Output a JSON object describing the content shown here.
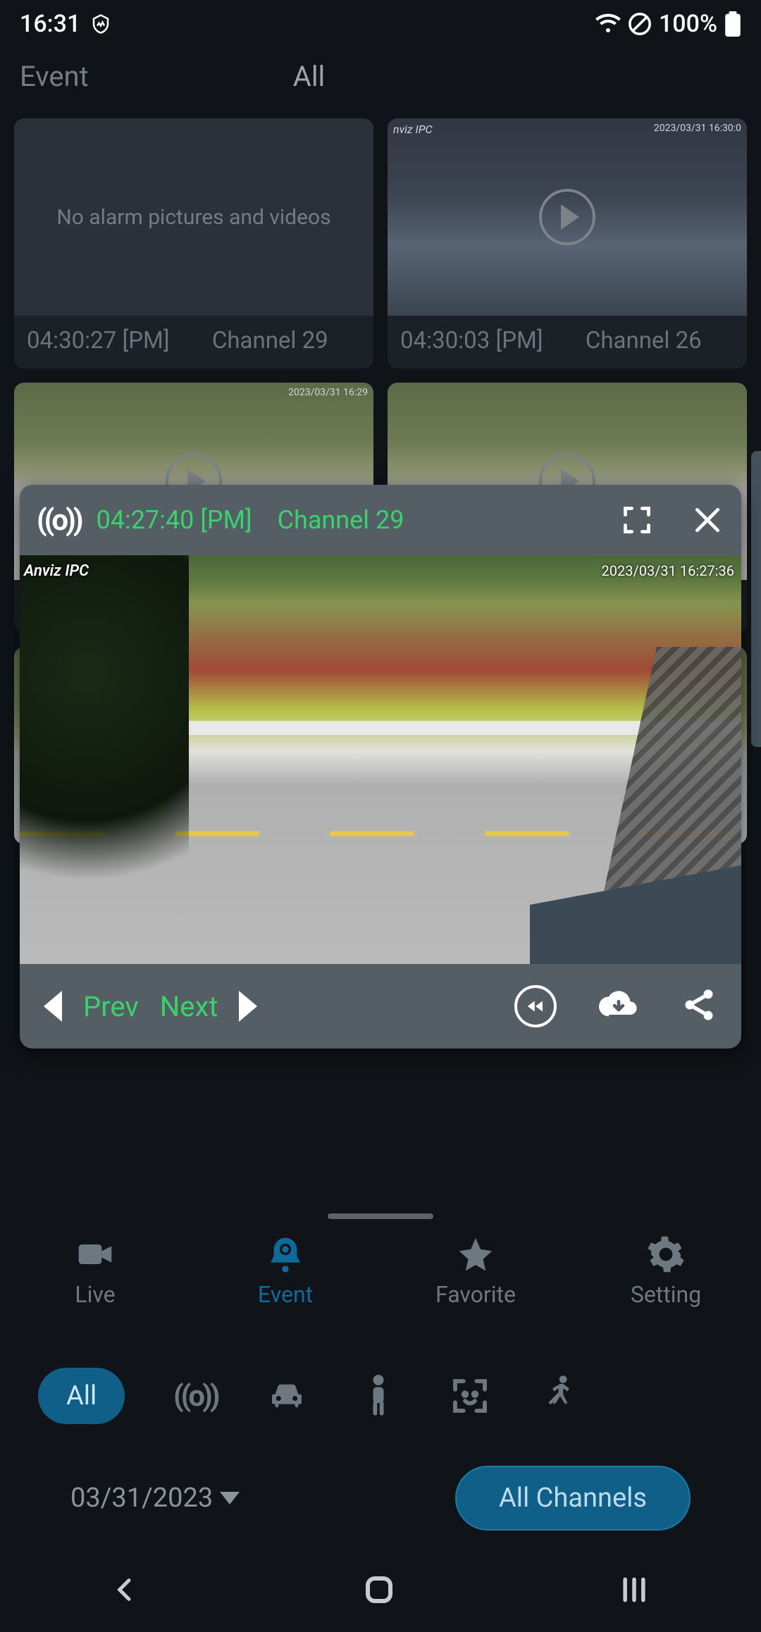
{
  "status": {
    "time": "16:31",
    "battery": "100%"
  },
  "top_tabs": {
    "event": "Event",
    "all": "All"
  },
  "cards": [
    {
      "empty_text": "No alarm pictures and videos",
      "time": "04:30:27 [PM]",
      "channel": "Channel 29"
    },
    {
      "time": "04:30:03 [PM]",
      "channel": "Channel 26"
    }
  ],
  "popup": {
    "time": "04:27:40 [PM]",
    "channel": "Channel 29",
    "overlay_tl": "Anviz IPC",
    "overlay_tr": "2023/03/31 16:27:36",
    "prev": "Prev",
    "next": "Next"
  },
  "nav": {
    "live": "Live",
    "event": "Event",
    "favorite": "Favorite",
    "setting": "Setting"
  },
  "filters": {
    "all": "All"
  },
  "date": "03/31/2023",
  "channel_chip": "All Channels"
}
